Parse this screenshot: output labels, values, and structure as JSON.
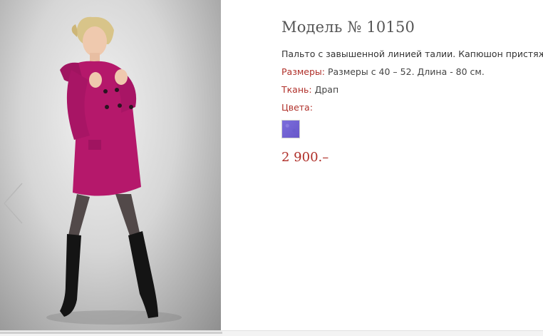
{
  "product": {
    "title": "Модель № 10150",
    "description": "Пальто с завышенной линией талии. Капюшон пристяжной.",
    "sizes_label": "Размеры:",
    "sizes_value": "Размеры с 40 – 52. Длина - 80 см.",
    "fabric_label": "Ткань:",
    "fabric_value": "Драп",
    "colors_label": "Цвета:",
    "colors": [
      "#7465d6"
    ],
    "price": "2 900.–"
  },
  "gallery": {
    "prev_icon": "chevron-left-icon",
    "coat_color": "#b5186b"
  }
}
